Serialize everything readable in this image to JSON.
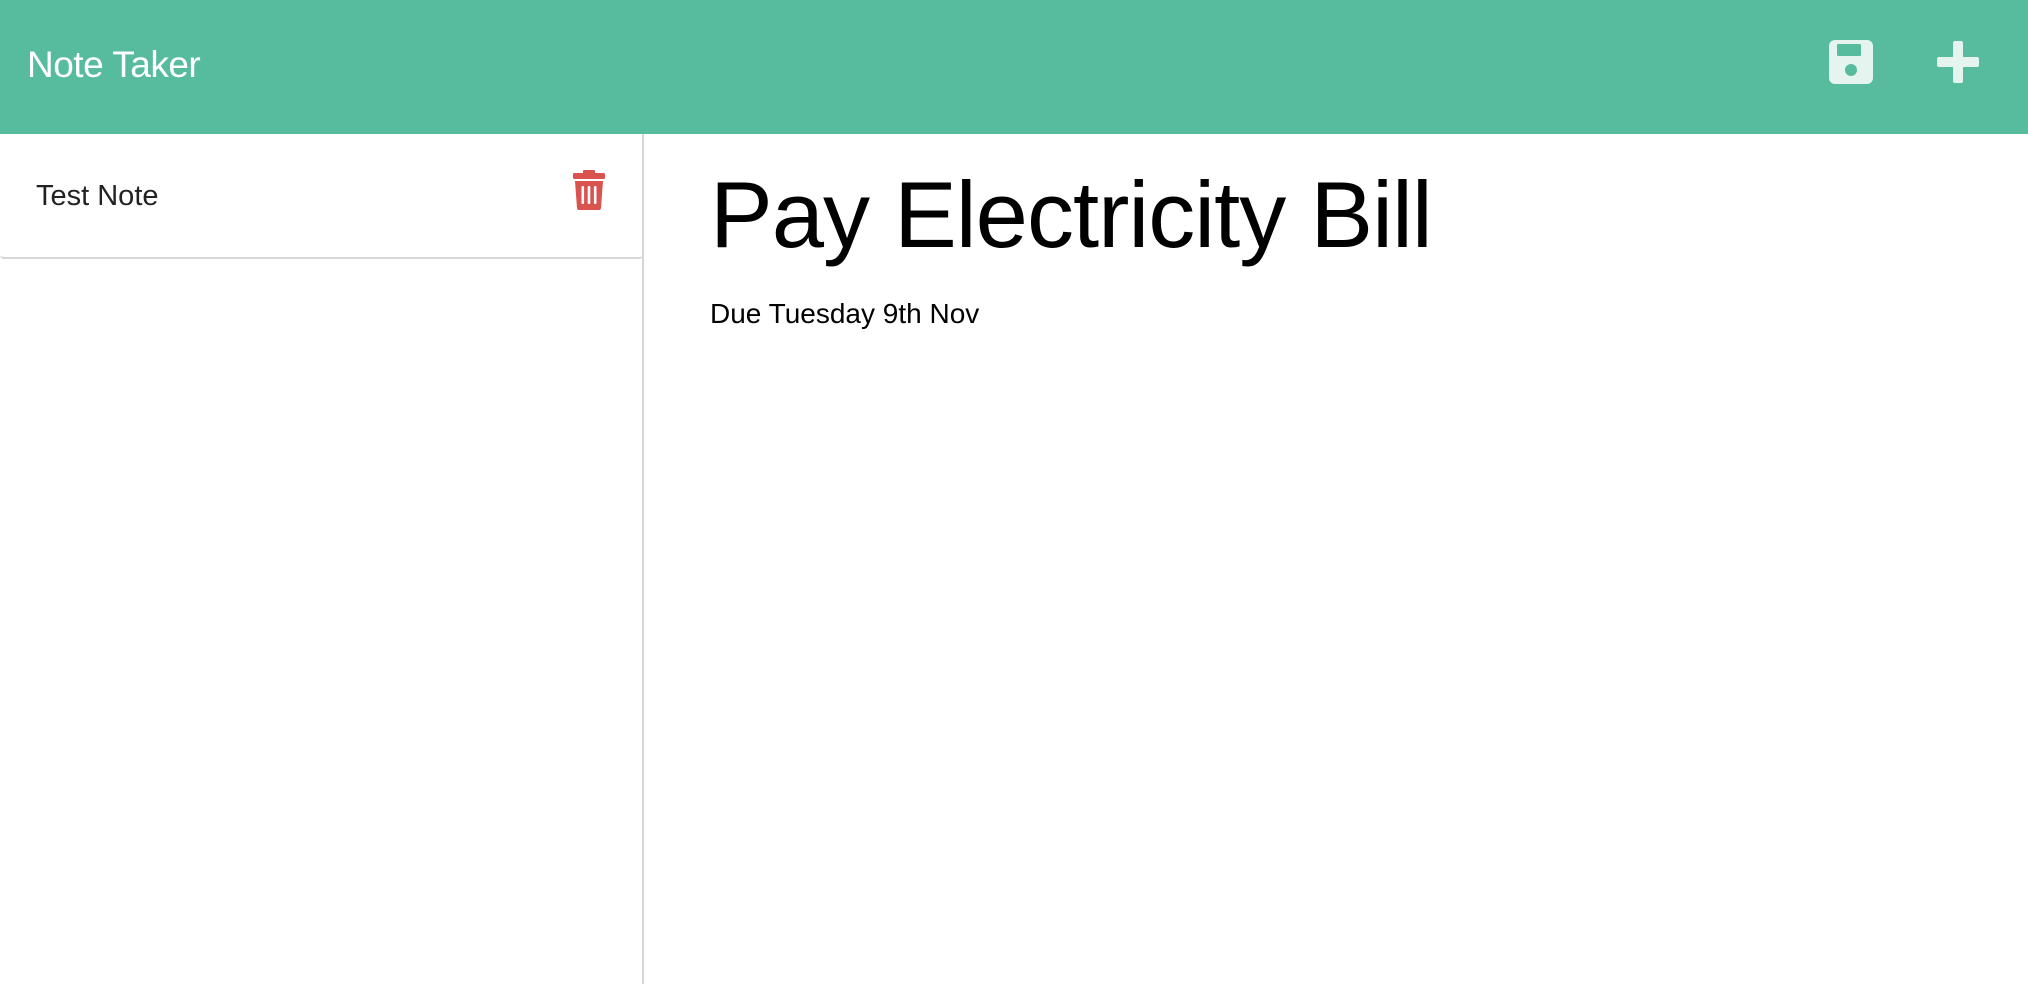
{
  "navbar": {
    "brand": "Note Taker",
    "save_icon": "floppy-disk-icon",
    "new_icon": "plus-icon",
    "color": "#57bb9e"
  },
  "sidebar": {
    "notes": [
      {
        "title": "Test Note",
        "delete_icon": "trash-icon"
      }
    ],
    "delete_color": "#d9534f"
  },
  "editor": {
    "title": "Pay Electricity Bill",
    "text": "Due Tuesday 9th Nov"
  }
}
